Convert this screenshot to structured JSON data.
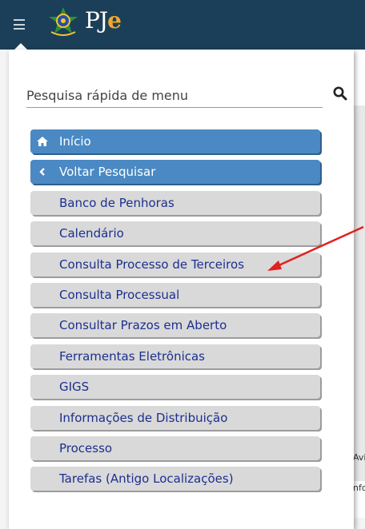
{
  "header": {
    "logo_text_main": "PJ",
    "logo_text_accent": "e"
  },
  "search": {
    "placeholder": "Pesquisa rápida de menu",
    "value": ""
  },
  "menu": {
    "home": {
      "label": "Início",
      "icon": "home-icon"
    },
    "back": {
      "label": "Voltar Pesquisar",
      "icon": "chevron-left-icon"
    },
    "items": [
      {
        "label": "Banco de Penhoras"
      },
      {
        "label": "Calendário"
      },
      {
        "label": "Consulta Processo de Terceiros"
      },
      {
        "label": "Consulta Processual"
      },
      {
        "label": "Consultar Prazos em Aberto"
      },
      {
        "label": "Ferramentas Eletrônicas"
      },
      {
        "label": "GIGS"
      },
      {
        "label": "Informações de Distribuição"
      },
      {
        "label": "Processo"
      },
      {
        "label": "Tarefas (Antigo Localizações)"
      }
    ]
  },
  "background_content": {
    "text_1": "Avi",
    "text_2": "nfo"
  },
  "annotation": {
    "arrow_target": "Consulta Processo de Terceiros",
    "arrow_color": "#e0211d"
  },
  "colors": {
    "topbar": "#1b3f58",
    "primary_button": "#4a89c3",
    "plain_button": "#d9d9d9",
    "plain_text": "#1c2f8f"
  }
}
